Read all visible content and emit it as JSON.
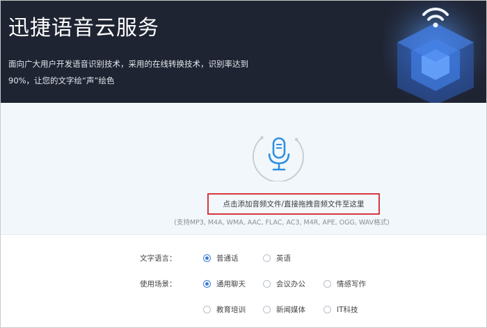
{
  "banner": {
    "title": "迅捷语音云服务",
    "description_line1": "面向广大用户开发语音识别技术，采用的在线转换技术，识别率达到",
    "description_line2": "90%，让您的文字绘“声”绘色"
  },
  "upload": {
    "icon": "microphone-icon",
    "drop_text": "点击添加音频文件/直接拖拽音频文件至这里",
    "formats_text": "(支持MP3, M4A, WMA, AAC, FLAC, AC3, M4R, APE, OGG, WAV格式)",
    "highlight_color": "#d9363e",
    "accent_color": "#3a7bd5"
  },
  "options": {
    "language": {
      "label": "文字语言：",
      "choices": [
        {
          "text": "普通话",
          "selected": true
        },
        {
          "text": "英语",
          "selected": false
        }
      ]
    },
    "scene": {
      "label": "使用场景：",
      "choices": [
        {
          "text": "通用聊天",
          "selected": true
        },
        {
          "text": "会议办公",
          "selected": false
        },
        {
          "text": "情感写作",
          "selected": false
        },
        {
          "text": "教育培训",
          "selected": false
        },
        {
          "text": "新闻媒体",
          "selected": false
        },
        {
          "text": "IT科技",
          "selected": false
        }
      ]
    }
  }
}
